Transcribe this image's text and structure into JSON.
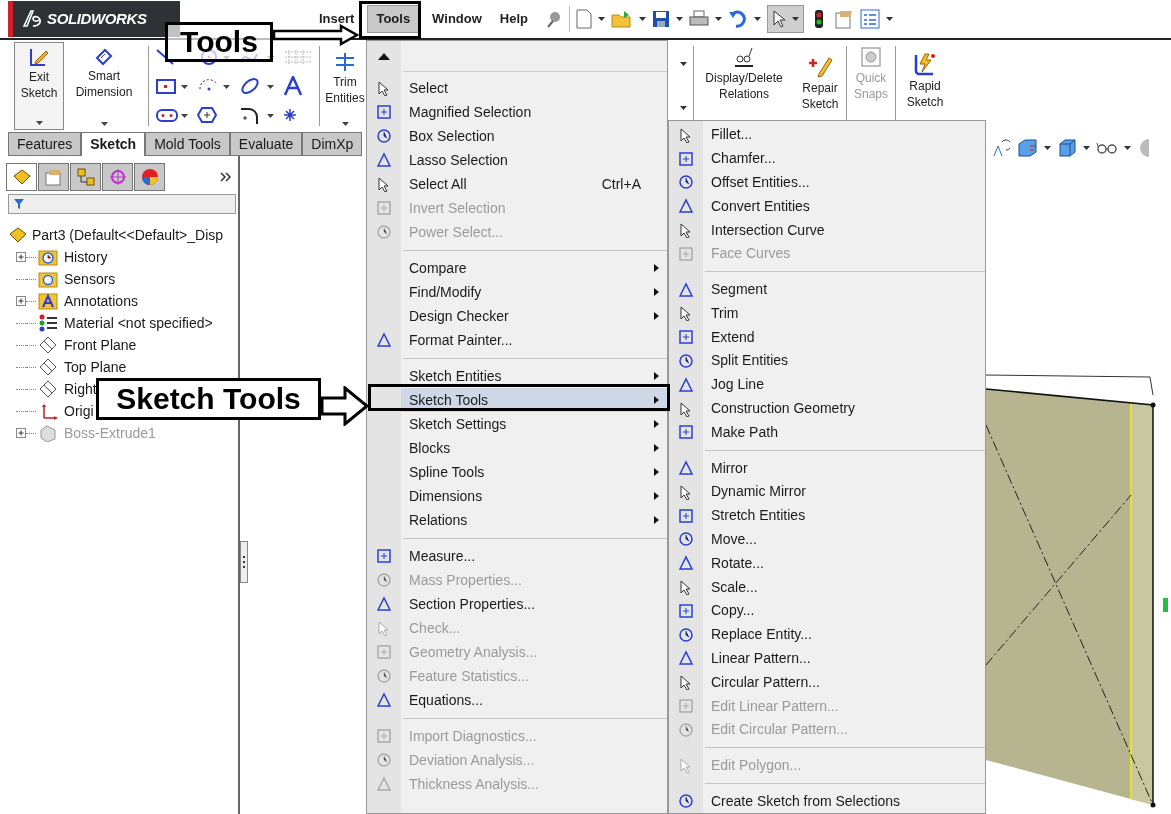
{
  "logo": "SOLIDWORKS",
  "menu_bar": [
    {
      "label": "Insert",
      "selected": false
    },
    {
      "label": "Tools",
      "selected": true
    },
    {
      "label": "Window",
      "selected": false
    },
    {
      "label": "Help",
      "selected": false
    }
  ],
  "ribbon_left": [
    {
      "label": "Exit Sketch",
      "active": true
    },
    {
      "label": "Smart Dimension",
      "active": false
    }
  ],
  "ribbon_trim": "Trim Entities",
  "ribbon_right": [
    {
      "label": "Display/Delete Relations",
      "disabled": false
    },
    {
      "label": "Repair Sketch",
      "disabled": false
    },
    {
      "label": "Quick Snaps",
      "disabled": true
    },
    {
      "label": "Rapid Sketch",
      "disabled": false
    }
  ],
  "panel_tabs": [
    {
      "selected": true
    },
    {
      "selected": false
    },
    {
      "selected": false
    },
    {
      "selected": false
    },
    {
      "selected": false
    }
  ],
  "tabs": [
    {
      "label": "Features",
      "selected": false
    },
    {
      "label": "Sketch",
      "selected": true
    },
    {
      "label": "Mold Tools",
      "selected": false
    },
    {
      "label": "Evaluate",
      "selected": false
    },
    {
      "label": "DimXp",
      "selected": false
    }
  ],
  "feature_tree": {
    "root": "Part3  (Default<<Default>_Disp",
    "items": [
      {
        "label": "History",
        "kind": "history",
        "has_children": true,
        "disabled": false
      },
      {
        "label": "Sensors",
        "kind": "sensors",
        "has_children": false,
        "disabled": false
      },
      {
        "label": "Annotations",
        "kind": "annotations",
        "has_children": true,
        "disabled": false
      },
      {
        "label": "Material <not specified>",
        "kind": "material",
        "has_children": false,
        "disabled": false
      },
      {
        "label": "Front Plane",
        "kind": "plane",
        "has_children": false,
        "disabled": false
      },
      {
        "label": "Top Plane",
        "kind": "plane",
        "has_children": false,
        "disabled": false
      },
      {
        "label": "Right",
        "kind": "plane",
        "has_children": false,
        "disabled": false
      },
      {
        "label": "Origi",
        "kind": "origin",
        "has_children": false,
        "disabled": false
      },
      {
        "label": "Boss-Extrude1",
        "kind": "feature",
        "has_children": true,
        "disabled": true
      }
    ]
  },
  "tools_menu": {
    "items": [
      {
        "kind": "item",
        "label": "Select",
        "has_icon": true,
        "disabled": false,
        "submenu": false,
        "selected": false
      },
      {
        "kind": "item",
        "label": "Magnified Selection",
        "has_icon": true,
        "disabled": false,
        "submenu": false,
        "selected": false
      },
      {
        "kind": "item",
        "label": "Box Selection",
        "has_icon": true,
        "disabled": false,
        "submenu": false,
        "selected": false
      },
      {
        "kind": "item",
        "label": "Lasso Selection",
        "has_icon": true,
        "disabled": false,
        "submenu": false,
        "selected": false
      },
      {
        "kind": "item",
        "label": "Select All",
        "shortcut": "Ctrl+A",
        "has_icon": true,
        "disabled": false,
        "submenu": false,
        "selected": false
      },
      {
        "kind": "item",
        "label": "Invert Selection",
        "has_icon": true,
        "disabled": true,
        "submenu": false,
        "selected": false
      },
      {
        "kind": "item",
        "label": "Power Select...",
        "has_icon": true,
        "disabled": true,
        "submenu": false,
        "selected": false
      },
      {
        "kind": "separator"
      },
      {
        "kind": "item",
        "label": "Compare",
        "has_icon": false,
        "disabled": false,
        "submenu": true,
        "selected": false
      },
      {
        "kind": "item",
        "label": "Find/Modify",
        "has_icon": false,
        "disabled": false,
        "submenu": true,
        "selected": false
      },
      {
        "kind": "item",
        "label": "Design Checker",
        "has_icon": false,
        "disabled": false,
        "submenu": true,
        "selected": false
      },
      {
        "kind": "item",
        "label": "Format Painter...",
        "has_icon": true,
        "disabled": false,
        "submenu": false,
        "selected": false
      },
      {
        "kind": "separator"
      },
      {
        "kind": "item",
        "label": "Sketch Entities",
        "has_icon": false,
        "disabled": false,
        "submenu": true,
        "selected": false
      },
      {
        "kind": "item",
        "label": "Sketch Tools",
        "has_icon": false,
        "disabled": false,
        "submenu": true,
        "selected": true
      },
      {
        "kind": "item",
        "label": "Sketch Settings",
        "has_icon": false,
        "disabled": false,
        "submenu": true,
        "selected": false
      },
      {
        "kind": "item",
        "label": "Blocks",
        "has_icon": false,
        "disabled": false,
        "submenu": true,
        "selected": false
      },
      {
        "kind": "item",
        "label": "Spline Tools",
        "has_icon": false,
        "disabled": false,
        "submenu": true,
        "selected": false
      },
      {
        "kind": "item",
        "label": "Dimensions",
        "has_icon": false,
        "disabled": false,
        "submenu": true,
        "selected": false
      },
      {
        "kind": "item",
        "label": "Relations",
        "has_icon": false,
        "disabled": false,
        "submenu": true,
        "selected": false
      },
      {
        "kind": "separator"
      },
      {
        "kind": "item",
        "label": "Measure...",
        "has_icon": true,
        "disabled": false,
        "submenu": false,
        "selected": false
      },
      {
        "kind": "item",
        "label": "Mass Properties...",
        "has_icon": true,
        "disabled": true,
        "submenu": false,
        "selected": false
      },
      {
        "kind": "item",
        "label": "Section Properties...",
        "has_icon": true,
        "disabled": false,
        "submenu": false,
        "selected": false
      },
      {
        "kind": "item",
        "label": "Check...",
        "has_icon": true,
        "disabled": true,
        "submenu": false,
        "selected": false
      },
      {
        "kind": "item",
        "label": "Geometry Analysis...",
        "has_icon": true,
        "disabled": true,
        "submenu": false,
        "selected": false
      },
      {
        "kind": "item",
        "label": "Feature Statistics...",
        "has_icon": true,
        "disabled": true,
        "submenu": false,
        "selected": false
      },
      {
        "kind": "item",
        "label": "Equations...",
        "has_icon": true,
        "disabled": false,
        "submenu": false,
        "selected": false
      },
      {
        "kind": "separator"
      },
      {
        "kind": "item",
        "label": "Import Diagnostics...",
        "has_icon": true,
        "disabled": true,
        "submenu": false,
        "selected": false
      },
      {
        "kind": "item",
        "label": "Deviation  Analysis...",
        "has_icon": true,
        "disabled": true,
        "submenu": false,
        "selected": false
      },
      {
        "kind": "item",
        "label": "Thickness Analysis...",
        "has_icon": true,
        "disabled": true,
        "submenu": false,
        "selected": false
      }
    ]
  },
  "sketch_tools_submenu": {
    "items": [
      {
        "kind": "item",
        "label": "Fillet...",
        "disabled": false
      },
      {
        "kind": "item",
        "label": "Chamfer...",
        "disabled": false
      },
      {
        "kind": "item",
        "label": "Offset Entities...",
        "disabled": false
      },
      {
        "kind": "item",
        "label": "Convert Entities",
        "disabled": false
      },
      {
        "kind": "item",
        "label": "Intersection Curve",
        "disabled": false
      },
      {
        "kind": "item",
        "label": "Face Curves",
        "disabled": true
      },
      {
        "kind": "separator"
      },
      {
        "kind": "item",
        "label": "Segment",
        "disabled": false
      },
      {
        "kind": "item",
        "label": "Trim",
        "disabled": false
      },
      {
        "kind": "item",
        "label": "Extend",
        "disabled": false
      },
      {
        "kind": "item",
        "label": "Split Entities",
        "disabled": false
      },
      {
        "kind": "item",
        "label": "Jog Line",
        "disabled": false
      },
      {
        "kind": "item",
        "label": "Construction Geometry",
        "disabled": false
      },
      {
        "kind": "item",
        "label": "Make Path",
        "disabled": false
      },
      {
        "kind": "separator"
      },
      {
        "kind": "item",
        "label": "Mirror",
        "disabled": false
      },
      {
        "kind": "item",
        "label": "Dynamic Mirror",
        "disabled": false
      },
      {
        "kind": "item",
        "label": "Stretch Entities",
        "disabled": false
      },
      {
        "kind": "item",
        "label": "Move...",
        "disabled": false
      },
      {
        "kind": "item",
        "label": "Rotate...",
        "disabled": false
      },
      {
        "kind": "item",
        "label": "Scale...",
        "disabled": false
      },
      {
        "kind": "item",
        "label": "Copy...",
        "disabled": false
      },
      {
        "kind": "item",
        "label": "Replace Entity...",
        "disabled": false
      },
      {
        "kind": "item",
        "label": "Linear Pattern...",
        "disabled": false
      },
      {
        "kind": "item",
        "label": "Circular Pattern...",
        "disabled": false
      },
      {
        "kind": "item",
        "label": "Edit Linear Pattern...",
        "disabled": true
      },
      {
        "kind": "item",
        "label": "Edit Circular Pattern...",
        "disabled": true
      },
      {
        "kind": "separator"
      },
      {
        "kind": "item",
        "label": "Edit Polygon...",
        "disabled": true
      },
      {
        "kind": "separator"
      },
      {
        "kind": "item",
        "label": "Create Sketch from Selections",
        "disabled": false
      }
    ]
  },
  "callouts": [
    {
      "text": "Tools"
    },
    {
      "text": "Sketch Tools"
    }
  ]
}
